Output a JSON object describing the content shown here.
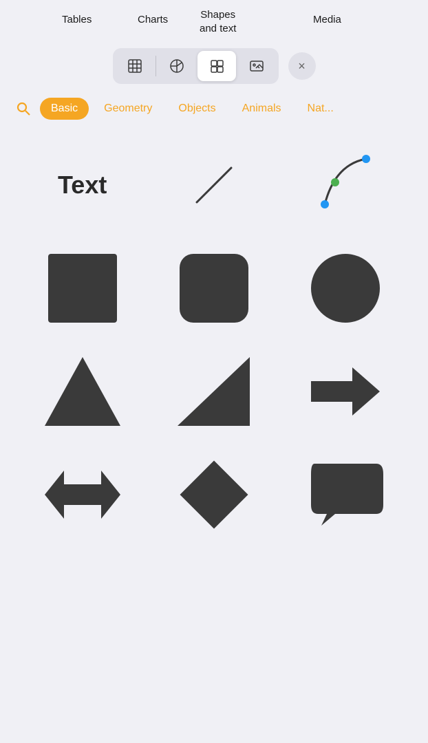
{
  "top_labels": {
    "tables": "Tables",
    "charts": "Charts",
    "shapes_and_text": "Shapes\nand text",
    "media": "Media"
  },
  "toolbar": {
    "tabs": [
      {
        "id": "tables",
        "label": "Tables",
        "active": false
      },
      {
        "id": "charts",
        "label": "Charts",
        "active": false
      },
      {
        "id": "shapes",
        "label": "Shapes and text",
        "active": true
      },
      {
        "id": "media",
        "label": "Media",
        "active": false
      }
    ],
    "close_label": "×"
  },
  "categories": [
    {
      "id": "basic",
      "label": "Basic",
      "active": true
    },
    {
      "id": "geometry",
      "label": "Geometry",
      "active": false
    },
    {
      "id": "objects",
      "label": "Objects",
      "active": false
    },
    {
      "id": "animals",
      "label": "Animals",
      "active": false
    },
    {
      "id": "nature",
      "label": "Nat...",
      "active": false
    }
  ],
  "shapes": [
    {
      "id": "text",
      "type": "text",
      "label": "Text"
    },
    {
      "id": "line",
      "type": "line"
    },
    {
      "id": "curve",
      "type": "curve"
    },
    {
      "id": "square",
      "type": "square"
    },
    {
      "id": "rounded_rect",
      "type": "rounded_rect"
    },
    {
      "id": "circle",
      "type": "circle"
    },
    {
      "id": "triangle",
      "type": "triangle"
    },
    {
      "id": "right_triangle",
      "type": "right_triangle"
    },
    {
      "id": "arrow",
      "type": "arrow"
    },
    {
      "id": "double_arrow",
      "type": "double_arrow"
    },
    {
      "id": "diamond",
      "type": "diamond"
    },
    {
      "id": "speech_bubble",
      "type": "speech_bubble"
    }
  ],
  "colors": {
    "accent": "#f5a623",
    "shape_fill": "#3a3a3a",
    "bg": "#f0f0f5"
  }
}
